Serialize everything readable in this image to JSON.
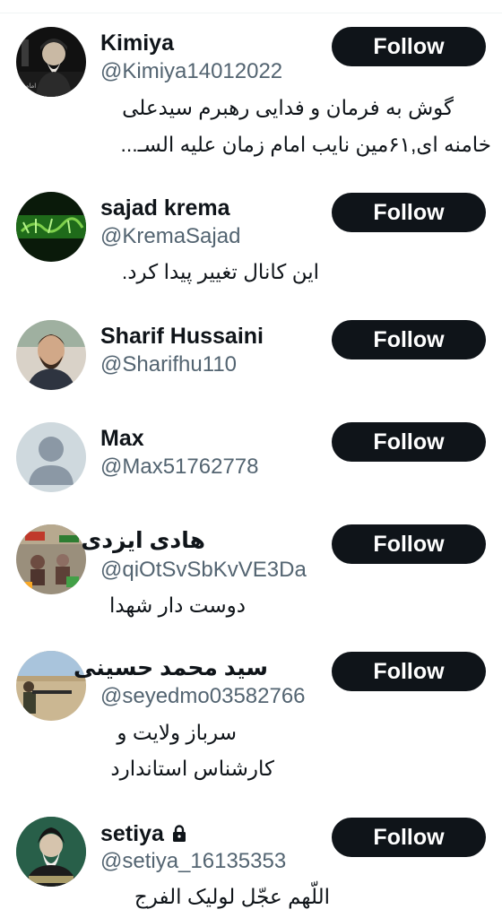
{
  "follow_label": "Follow",
  "users": [
    {
      "name": "Kimiya",
      "handle": "@Kimiya14012022",
      "bio_lines": [
        "گوش به فرمان و فدایی رهبرم سیدعلی",
        "خامنه ای,۶۱مین نایب امام زمان علیه السـ..."
      ],
      "avatar": "portrait-dark",
      "protected": false
    },
    {
      "name": "sajad krema",
      "handle": "@KremaSajad",
      "bio_lines": [
        "این کانال تغییر پیدا کرد."
      ],
      "avatar": "green-calligraphy",
      "protected": false
    },
    {
      "name": "Sharif Hussaini",
      "handle": "@Sharifhu110",
      "bio_lines": [],
      "avatar": "portrait-young-man",
      "protected": false
    },
    {
      "name": "Max",
      "handle": "@Max51762778",
      "bio_lines": [],
      "avatar": "default-avatar",
      "protected": false
    },
    {
      "name": "هادی ایزدی",
      "handle": "@qiOtSvSbKvVE3Da",
      "bio_lines": [
        "دوست دار شهدا"
      ],
      "avatar": "collage",
      "protected": false
    },
    {
      "name": "سید محمد حسینی",
      "handle": "@seyedmo03582766",
      "bio_lines": [
        "سرباز ولایت و",
        "کارشناس استاندارد"
      ],
      "avatar": "soldier-field",
      "protected": false
    },
    {
      "name": "setiya",
      "handle": "@setiya_16135353",
      "bio_lines": [
        "اللّهم عجّل لولیک الفرج"
      ],
      "avatar": "portrait-leader",
      "protected": true
    }
  ],
  "colors": {
    "text": "#0f1419",
    "secondary": "#536471",
    "button_bg": "#0f1419",
    "button_text": "#ffffff",
    "divider": "#eff3f4"
  }
}
